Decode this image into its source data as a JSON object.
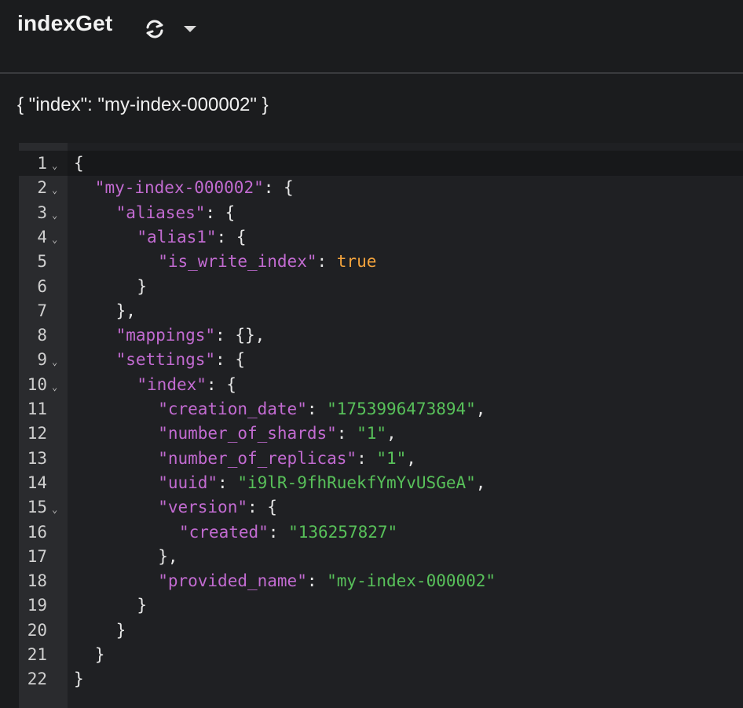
{
  "header": {
    "title": "indexGet",
    "refresh_icon": "refresh-icon",
    "dropdown_icon": "caret-down-icon"
  },
  "params": "{ \"index\": \"my-index-000002\" }",
  "colors": {
    "key": "#c26bd1",
    "string": "#58c15a",
    "boolean": "#f3a33c",
    "punct": "#e6e6e6"
  },
  "editor": {
    "lines": [
      {
        "n": "1",
        "fold": true,
        "indent": 0,
        "tokens": [
          {
            "t": "p",
            "v": "{"
          }
        ]
      },
      {
        "n": "2",
        "fold": true,
        "indent": 1,
        "tokens": [
          {
            "t": "k",
            "v": "\"my-index-000002\""
          },
          {
            "t": "p",
            "v": ": {"
          }
        ]
      },
      {
        "n": "3",
        "fold": true,
        "indent": 2,
        "tokens": [
          {
            "t": "k",
            "v": "\"aliases\""
          },
          {
            "t": "p",
            "v": ": {"
          }
        ]
      },
      {
        "n": "4",
        "fold": true,
        "indent": 3,
        "tokens": [
          {
            "t": "k",
            "v": "\"alias1\""
          },
          {
            "t": "p",
            "v": ": {"
          }
        ]
      },
      {
        "n": "5",
        "fold": false,
        "indent": 4,
        "tokens": [
          {
            "t": "k",
            "v": "\"is_write_index\""
          },
          {
            "t": "p",
            "v": ": "
          },
          {
            "t": "b",
            "v": "true"
          }
        ]
      },
      {
        "n": "6",
        "fold": false,
        "indent": 3,
        "tokens": [
          {
            "t": "p",
            "v": "}"
          }
        ]
      },
      {
        "n": "7",
        "fold": false,
        "indent": 2,
        "tokens": [
          {
            "t": "p",
            "v": "},"
          }
        ]
      },
      {
        "n": "8",
        "fold": false,
        "indent": 2,
        "tokens": [
          {
            "t": "k",
            "v": "\"mappings\""
          },
          {
            "t": "p",
            "v": ": {},"
          }
        ]
      },
      {
        "n": "9",
        "fold": true,
        "indent": 2,
        "tokens": [
          {
            "t": "k",
            "v": "\"settings\""
          },
          {
            "t": "p",
            "v": ": {"
          }
        ]
      },
      {
        "n": "10",
        "fold": true,
        "indent": 3,
        "tokens": [
          {
            "t": "k",
            "v": "\"index\""
          },
          {
            "t": "p",
            "v": ": {"
          }
        ]
      },
      {
        "n": "11",
        "fold": false,
        "indent": 4,
        "tokens": [
          {
            "t": "k",
            "v": "\"creation_date\""
          },
          {
            "t": "p",
            "v": ": "
          },
          {
            "t": "s",
            "v": "\"1753996473894\""
          },
          {
            "t": "p",
            "v": ","
          }
        ]
      },
      {
        "n": "12",
        "fold": false,
        "indent": 4,
        "tokens": [
          {
            "t": "k",
            "v": "\"number_of_shards\""
          },
          {
            "t": "p",
            "v": ": "
          },
          {
            "t": "s",
            "v": "\"1\""
          },
          {
            "t": "p",
            "v": ","
          }
        ]
      },
      {
        "n": "13",
        "fold": false,
        "indent": 4,
        "tokens": [
          {
            "t": "k",
            "v": "\"number_of_replicas\""
          },
          {
            "t": "p",
            "v": ": "
          },
          {
            "t": "s",
            "v": "\"1\""
          },
          {
            "t": "p",
            "v": ","
          }
        ]
      },
      {
        "n": "14",
        "fold": false,
        "indent": 4,
        "tokens": [
          {
            "t": "k",
            "v": "\"uuid\""
          },
          {
            "t": "p",
            "v": ": "
          },
          {
            "t": "s",
            "v": "\"i9lR-9fhRuekfYmYvUSGeA\""
          },
          {
            "t": "p",
            "v": ","
          }
        ]
      },
      {
        "n": "15",
        "fold": true,
        "indent": 4,
        "tokens": [
          {
            "t": "k",
            "v": "\"version\""
          },
          {
            "t": "p",
            "v": ": {"
          }
        ]
      },
      {
        "n": "16",
        "fold": false,
        "indent": 5,
        "tokens": [
          {
            "t": "k",
            "v": "\"created\""
          },
          {
            "t": "p",
            "v": ": "
          },
          {
            "t": "s",
            "v": "\"136257827\""
          }
        ]
      },
      {
        "n": "17",
        "fold": false,
        "indent": 4,
        "tokens": [
          {
            "t": "p",
            "v": "},"
          }
        ]
      },
      {
        "n": "18",
        "fold": false,
        "indent": 4,
        "tokens": [
          {
            "t": "k",
            "v": "\"provided_name\""
          },
          {
            "t": "p",
            "v": ": "
          },
          {
            "t": "s",
            "v": "\"my-index-000002\""
          }
        ]
      },
      {
        "n": "19",
        "fold": false,
        "indent": 3,
        "tokens": [
          {
            "t": "p",
            "v": "}"
          }
        ]
      },
      {
        "n": "20",
        "fold": false,
        "indent": 2,
        "tokens": [
          {
            "t": "p",
            "v": "}"
          }
        ]
      },
      {
        "n": "21",
        "fold": false,
        "indent": 1,
        "tokens": [
          {
            "t": "p",
            "v": "}"
          }
        ]
      },
      {
        "n": "22",
        "fold": false,
        "indent": 0,
        "tokens": [
          {
            "t": "p",
            "v": "}"
          }
        ]
      }
    ]
  }
}
